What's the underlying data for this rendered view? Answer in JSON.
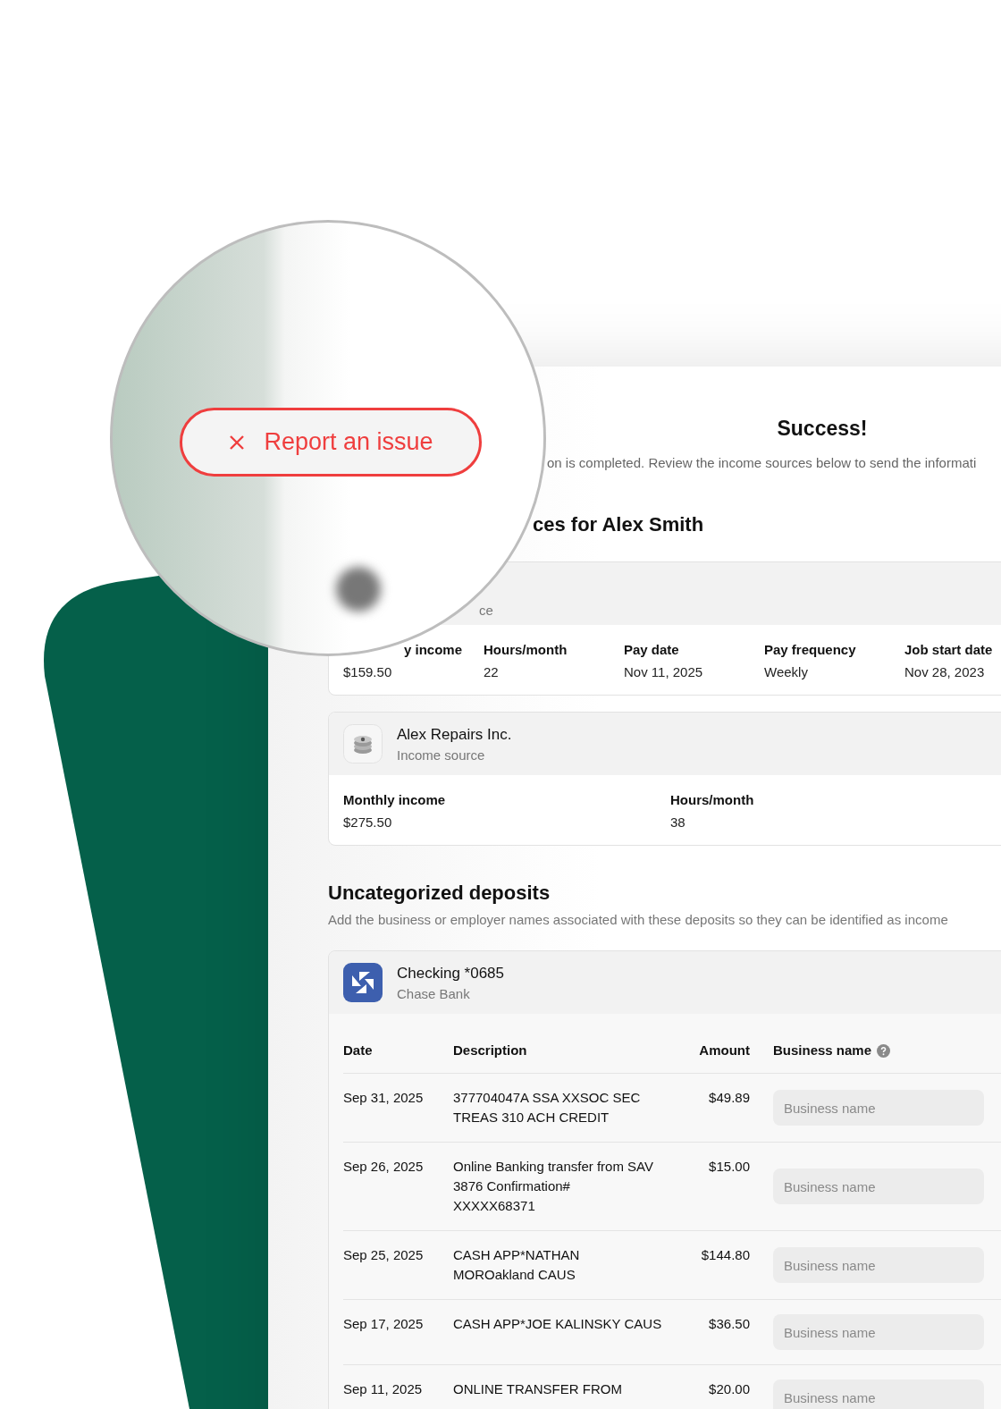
{
  "report_button": {
    "label": "Report an issue"
  },
  "header": {
    "title": "Success!",
    "subtitle": "on is completed. Review the income sources below to send the informati"
  },
  "income_heading": "ces for Alex Smith",
  "income_sources": [
    {
      "kind": "hidden",
      "subtitle": "ce",
      "fields": [
        {
          "label": "y income",
          "value": "$159.50"
        },
        {
          "label": "Hours/month",
          "value": "22"
        },
        {
          "label": "Pay date",
          "value": "Nov 11, 2025"
        },
        {
          "label": "Pay frequency",
          "value": "Weekly"
        },
        {
          "label": "Job start date",
          "value": "Nov 28, 2023"
        }
      ]
    },
    {
      "kind": "coins",
      "name": "Alex Repairs Inc.",
      "subtitle": "Income source",
      "fields": [
        {
          "label": "Monthly income",
          "value": "$275.50"
        },
        {
          "label": "Hours/month",
          "value": "38"
        }
      ]
    }
  ],
  "deposits": {
    "title": "Uncategorized deposits",
    "subtitle": "Add the business or employer names associated with these deposits so they can be identified as income",
    "account": {
      "name": "Checking *0685",
      "bank": "Chase Bank"
    },
    "columns": [
      "Date",
      "Description",
      "Amount",
      "Business name"
    ],
    "rows": [
      {
        "date": "Sep 31, 2025",
        "description": [
          "377704047A SSA XXSOC SEC",
          "TREAS 310 ACH CREDIT"
        ],
        "amount": "$49.89",
        "placeholder": "Business name"
      },
      {
        "date": "Sep 26, 2025",
        "description": [
          "Online Banking transfer from SAV",
          "3876 Confirmation#",
          "XXXXX68371"
        ],
        "amount": "$15.00",
        "placeholder": "Business name"
      },
      {
        "date": "Sep 25, 2025",
        "description": [
          "CASH APP*NATHAN",
          "MOROakland CAUS"
        ],
        "amount": "$144.80",
        "placeholder": "Business name"
      },
      {
        "date": "Sep 17, 2025",
        "description": [
          "CASH APP*JOE KALINSKY CAUS"
        ],
        "amount": "$36.50",
        "placeholder": "Business name"
      },
      {
        "date": "Sep 11, 2025",
        "description": [
          "ONLINE TRANSFER FROM"
        ],
        "amount": "$20.00",
        "placeholder": "Business name"
      }
    ]
  }
}
